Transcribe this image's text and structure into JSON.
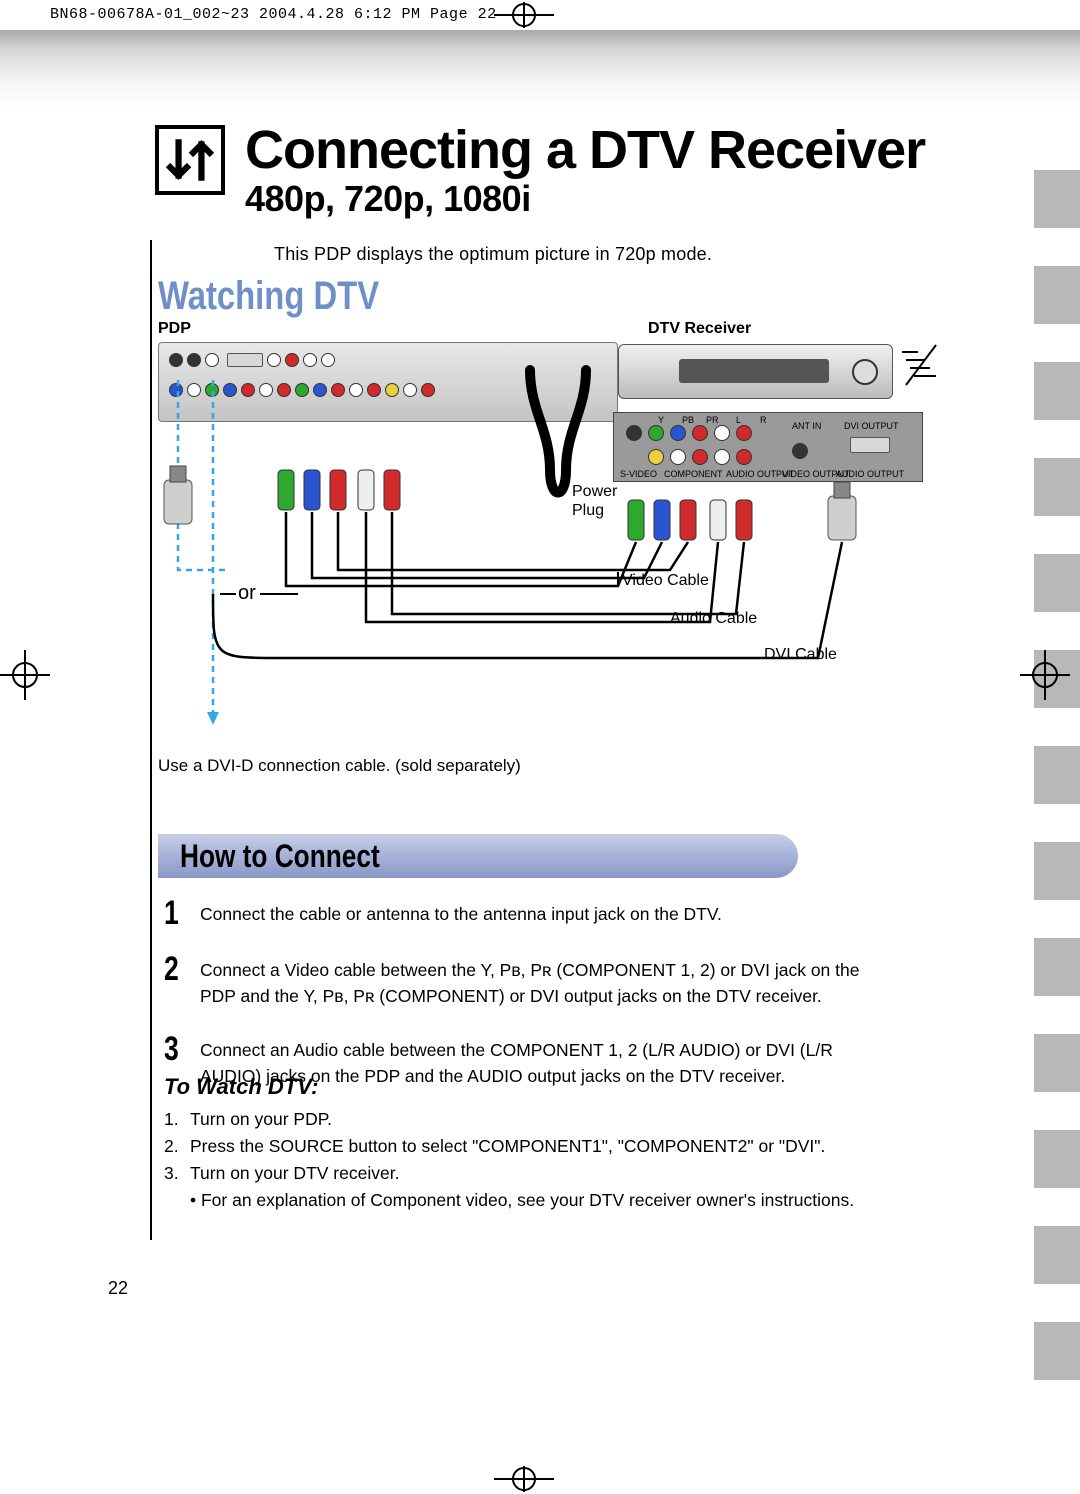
{
  "header_strip": "BN68-00678A-01_002~23  2004.4.28  6:12 PM  Page 22",
  "title": "Connecting a DTV Receiver",
  "subtitle": "480p, 720p, 1080i",
  "intro": "This PDP displays the optimum picture in 720p mode.",
  "watching": "Watching DTV",
  "diagram": {
    "pdp_label": "PDP",
    "dtv_label": "DTV Receiver",
    "power_plug": "Power\nPlug",
    "video_cable": "Video Cable",
    "audio_cable": "Audio Cable",
    "dvi_cable": "DVI Cable",
    "or": "or",
    "rec_panel": {
      "y": "Y",
      "pb": "PB",
      "pr": "PR",
      "l": "L",
      "r": "R",
      "ant_in": "ANT IN",
      "dvi_out": "DVI OUTPUT",
      "svideo": "S-VIDEO",
      "component": "COMPONENT",
      "audio_out": "AUDIO OUTPUT",
      "video_out": "VIDEO OUTPUT",
      "audio_out2": "AUDIO OUTPUT"
    }
  },
  "dvi_note": "Use a DVI-D connection cable. (sold separately)",
  "how_title": "How to Connect",
  "steps": [
    "Connect the cable or antenna to the antenna input jack on the DTV.",
    "Connect a Video cable between the Y, Pʙ, Pʀ (COMPONENT 1, 2) or DVI jack on the PDP and the Y, Pʙ, Pʀ (COMPONENT) or DVI output jacks on the DTV receiver.",
    "Connect an Audio cable between the COMPONENT 1, 2 (L/R AUDIO) or DVI (L/R AUDIO) jacks on the  PDP and the AUDIO output jacks on the DTV receiver."
  ],
  "to_watch_title": "To Watch DTV:",
  "to_watch": [
    "Turn on your PDP.",
    "Press the SOURCE button to select \"COMPONENT1\", \"COMPONENT2\" or \"DVI\".",
    "Turn on your DTV receiver."
  ],
  "to_watch_bullet": "• For an explanation of Component video, see your DTV receiver owner's instructions.",
  "page_number": "22"
}
